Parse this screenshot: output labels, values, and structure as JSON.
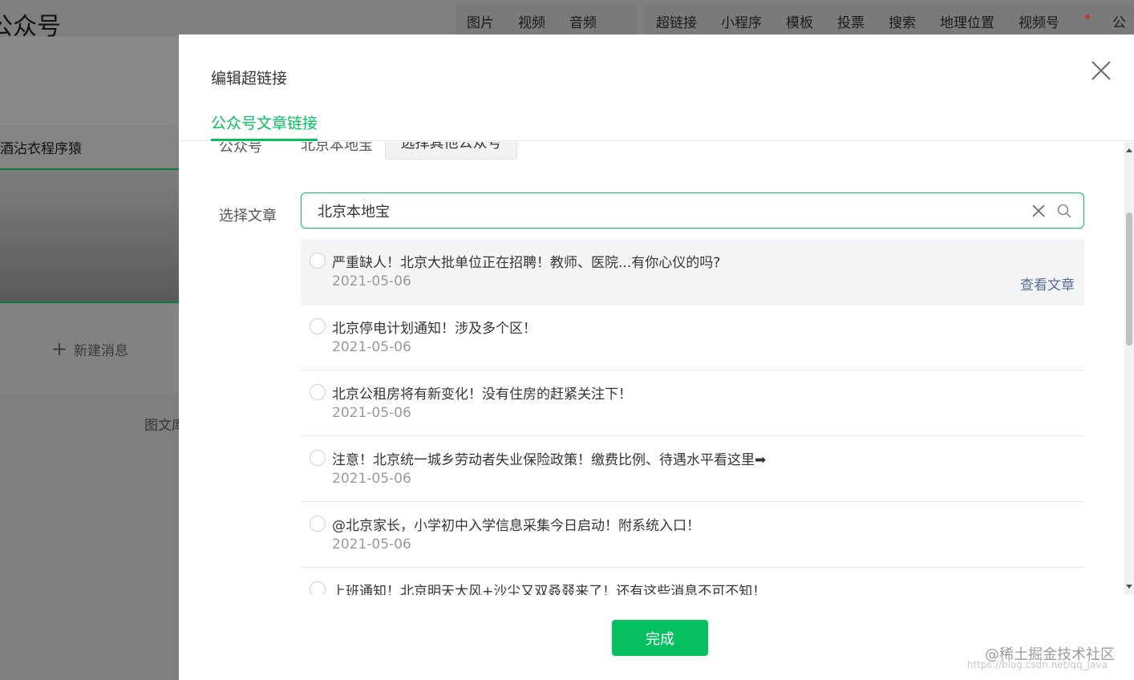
{
  "background": {
    "title": "公众号",
    "toolbar_left": [
      "图片",
      "视频",
      "音频"
    ],
    "toolbar_right": [
      "超链接",
      "小程序",
      "模板",
      "投票",
      "搜索",
      "地理位置",
      "视频号",
      "公"
    ],
    "account_name": "酒沾衣程序猿",
    "new_message_label": "新建消息",
    "media_label": "图文库"
  },
  "dialog": {
    "title": "编辑超链接",
    "tab_label": "公众号文章链接",
    "account_label": "公众号",
    "account_name": "北京本地宝",
    "other_account_button": "选择其他公众号",
    "select_article_label": "选择文章",
    "search_value": "北京本地宝",
    "view_article_link": "查看文章",
    "done_button": "完成",
    "articles": [
      {
        "title": "严重缺人！北京大批单位正在招聘！教师、医院...有你心仪的吗?",
        "date": "2021-05-06"
      },
      {
        "title": "北京停电计划通知！涉及多个区！",
        "date": "2021-05-06"
      },
      {
        "title": "北京公租房将有新变化！没有住房的赶紧关注下！",
        "date": "2021-05-06"
      },
      {
        "title": "注意！北京统一城乡劳动者失业保险政策！缴费比例、待遇水平看这里➡",
        "date": "2021-05-06"
      },
      {
        "title": "@北京家长，小学初中入学信息采集今日启动！附系统入口！",
        "date": "2021-05-06"
      },
      {
        "title": "上班通知！北京明天大风+沙尘又双叒叕来了！还有这些消息不可不知！",
        "date": ""
      }
    ]
  },
  "watermark": "@稀土掘金技术社区",
  "watermark_url": "https://blog.csdn.net/qq_java"
}
